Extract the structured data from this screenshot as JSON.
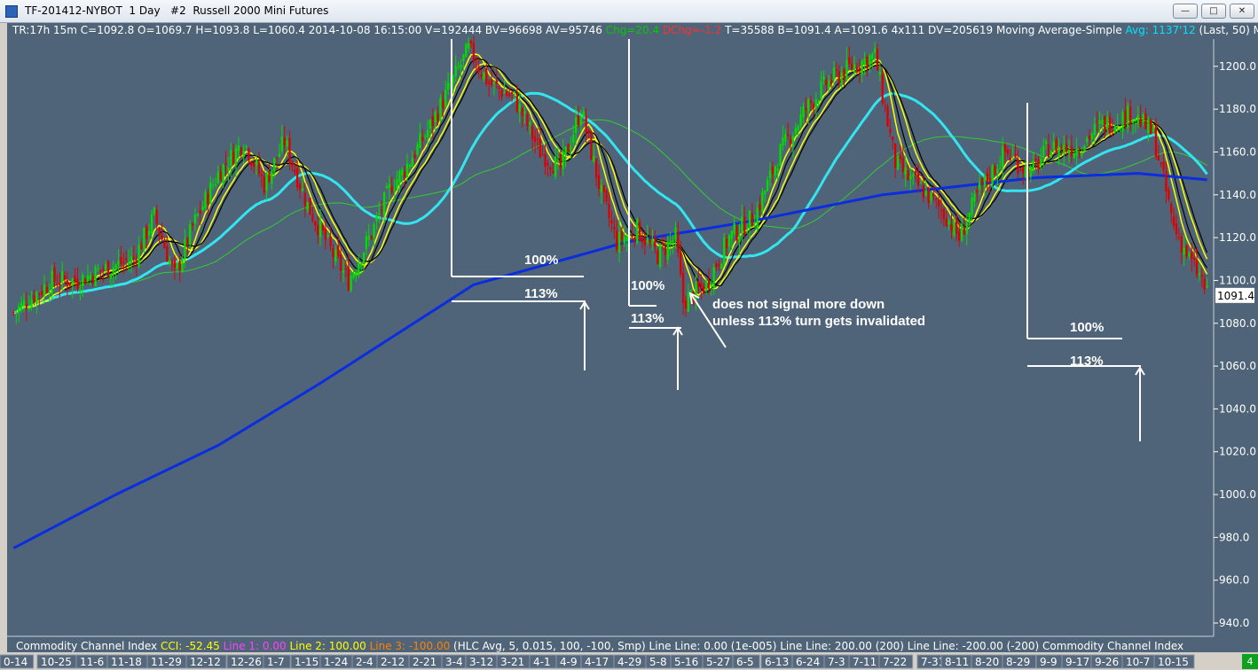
{
  "window": {
    "title": "TF-201412-NYBOT  1 Day   #2  Russell 2000 Mini Futures",
    "minimize": "—",
    "maximize": "□",
    "close": "✕"
  },
  "infobar": {
    "main": "TR:17h 15m C=1092.8 O=1069.7 H=1093.8 L=1060.4 2014-10-08 16:15:00 V=192444 BV=96698 AV=95746 ",
    "chg": "Chg=20.4",
    "dchg": "DChg=-1.2",
    "rest": " T=35588 B=1091.4 A=1091.6 4x111 DV=205619 Moving Average-Simple ",
    "avg": "Avg: 1137'12",
    "tail": " (Last, 50)  Mov"
  },
  "indicator_bar": {
    "name": "Commodity Channel Index  ",
    "cci": "CCI: -52.45  ",
    "line1": "Line 1: 0.00  ",
    "line2": "Line 2: 100.00  ",
    "line3": "Line 3: -100.00  ",
    "params": "(HLC Avg, 5, 0.015, 100, -100, Smp)  Line  Line: 0.00   (1e-005)  Line   Line: 200.00   (200)  Line   Line: -200.00   (-200)  Commodity Channel Index"
  },
  "price_marker": "1091.4",
  "corner_badge": "4",
  "colors": {
    "background": "#4f6478",
    "up_candle": "#00dd00",
    "down_candle": "#dd0000",
    "ma_black": "#000000",
    "ma_yellow": "#ffff00",
    "ma_cyan": "#33e5f0",
    "ma_green": "#33cc33",
    "ma_blue": "#0a2de0",
    "annotation": "#ffffff"
  },
  "annotations": {
    "a100_1": "100%",
    "a113_1": "113%",
    "a100_2": "100%",
    "a113_2": "113%",
    "note_line1": "does not signal more down",
    "note_line2": "unless 113% turn gets invalidated",
    "a100_3": "100%",
    "a113_3": "113%"
  },
  "chart_data": {
    "type": "candlestick",
    "ylim": [
      930,
      1210
    ],
    "y_ticks": [
      940,
      960,
      980,
      1000,
      1020,
      1040,
      1060,
      1080,
      1100,
      1120,
      1140,
      1160,
      1180,
      1200
    ],
    "x_tick_labels": [
      "0-14",
      "10-25",
      "11-6",
      "11-18",
      "11-29",
      "12-12",
      "12-26",
      "1-7",
      "1-15",
      "1-24",
      "2-4",
      "2-12",
      "2-21",
      "3-4",
      "3-12",
      "3-21",
      "4-1",
      "4-9",
      "4-17",
      "4-29",
      "5-8",
      "5-16",
      "5-27",
      "6-5",
      "6-13",
      "6-24",
      "7-3",
      "7-11",
      "7-22",
      "7-31",
      "8-11",
      "8-20",
      "8-29",
      "9-9",
      "9-17",
      "9-26",
      "10-7",
      "10-15"
    ],
    "series": [
      {
        "name": "TF-201412-NYBOT",
        "close_points": [
          [
            0,
            1085
          ],
          [
            15,
            1100
          ],
          [
            25,
            1100
          ],
          [
            35,
            1105
          ],
          [
            47,
            1110
          ],
          [
            55,
            1130
          ],
          [
            63,
            1102
          ],
          [
            70,
            1125
          ],
          [
            80,
            1150
          ],
          [
            90,
            1165
          ],
          [
            98,
            1145
          ],
          [
            106,
            1165
          ],
          [
            115,
            1135
          ],
          [
            125,
            1112
          ],
          [
            131,
            1100
          ],
          [
            140,
            1122
          ],
          [
            148,
            1145
          ],
          [
            152,
            1150
          ],
          [
            163,
            1172
          ],
          [
            173,
            1196
          ],
          [
            178,
            1208
          ],
          [
            186,
            1192
          ],
          [
            196,
            1185
          ],
          [
            206,
            1160
          ],
          [
            214,
            1152
          ],
          [
            222,
            1180
          ],
          [
            230,
            1140
          ],
          [
            236,
            1118
          ],
          [
            244,
            1124
          ],
          [
            252,
            1112
          ],
          [
            259,
            1120
          ],
          [
            262,
            1090
          ],
          [
            271,
            1098
          ],
          [
            280,
            1120
          ],
          [
            290,
            1130
          ],
          [
            300,
            1160
          ],
          [
            310,
            1180
          ],
          [
            318,
            1192
          ],
          [
            328,
            1200
          ],
          [
            337,
            1205
          ],
          [
            345,
            1155
          ],
          [
            350,
            1148
          ],
          [
            356,
            1142
          ],
          [
            365,
            1130
          ],
          [
            370,
            1120
          ],
          [
            378,
            1142
          ],
          [
            388,
            1160
          ],
          [
            398,
            1150
          ],
          [
            405,
            1162
          ],
          [
            416,
            1162
          ],
          [
            425,
            1172
          ],
          [
            438,
            1178
          ],
          [
            446,
            1168
          ],
          [
            454,
            1125
          ],
          [
            460,
            1110
          ],
          [
            465,
            1100
          ],
          [
            467,
            1093
          ]
        ]
      }
    ],
    "moving_averages": [
      "black",
      "yellow",
      "cyan",
      "green",
      "blue"
    ],
    "ma_blue_points": [
      [
        0,
        975
      ],
      [
        40,
        1000
      ],
      [
        80,
        1023
      ],
      [
        120,
        1052
      ],
      [
        180,
        1098
      ],
      [
        240,
        1118
      ],
      [
        290,
        1128
      ],
      [
        340,
        1140
      ],
      [
        400,
        1148
      ],
      [
        440,
        1150
      ],
      [
        467,
        1147
      ]
    ]
  }
}
